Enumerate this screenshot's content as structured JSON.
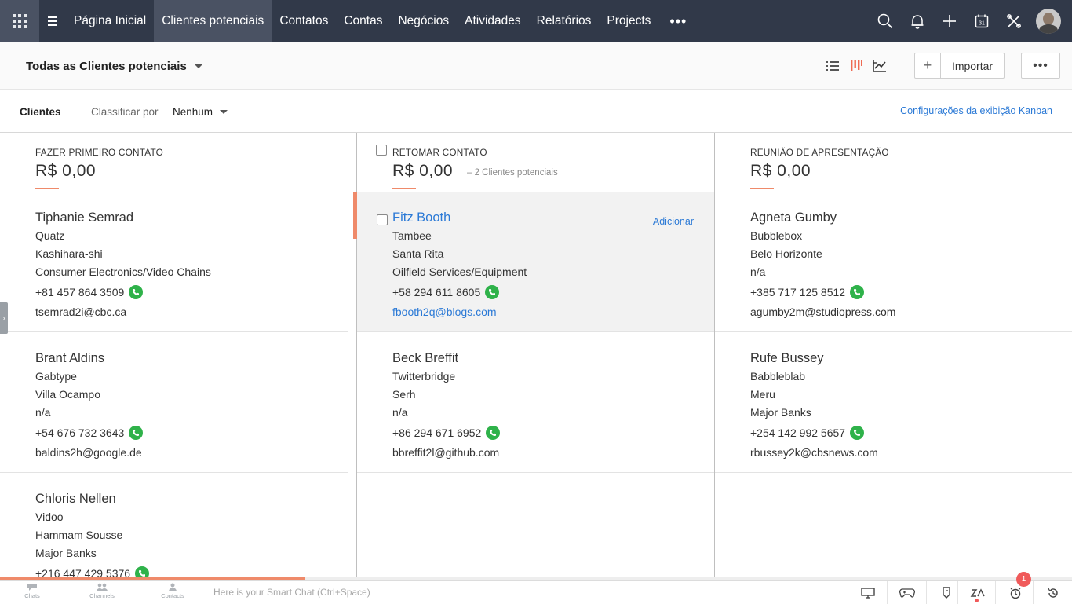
{
  "nav": {
    "tabs": [
      {
        "label": "Página Inicial"
      },
      {
        "label": "Clientes potenciais"
      },
      {
        "label": "Contatos"
      },
      {
        "label": "Contas"
      },
      {
        "label": "Negócios"
      },
      {
        "label": "Atividades"
      },
      {
        "label": "Relatórios"
      },
      {
        "label": "Projects"
      }
    ],
    "active_tab": "Clientes potenciais",
    "more_label": "•••",
    "calendar_day": "31"
  },
  "toolbar": {
    "view_title": "Todas as Clientes potenciais",
    "add_label": "+",
    "import_label": "Importar",
    "more_label": "•••"
  },
  "sortbar": {
    "module": "Clientes",
    "sort_label": "Classificar por",
    "sort_value": "Nenhum",
    "kanban_settings": "Configurações da exibição Kanban"
  },
  "columns": [
    {
      "title": "FAZER PRIMEIRO CONTATO",
      "amount": "R$ 0,00",
      "count": "",
      "cards": [
        {
          "name": "Tiphanie Semrad",
          "company": "Quatz",
          "city": "Kashihara-shi",
          "industry": "Consumer Electronics/Video Chains",
          "phone": "+81 457 864 3509",
          "email": "tsemrad2i@cbc.ca"
        },
        {
          "name": "Brant Aldins",
          "company": "Gabtype",
          "city": "Villa Ocampo",
          "industry": "n/a",
          "phone": "+54 676 732 3643",
          "email": "baldins2h@google.de"
        },
        {
          "name": "Chloris Nellen",
          "company": "Vidoo",
          "city": "Hammam Sousse",
          "industry": "Major Banks",
          "phone": "+216 447 429 5376",
          "email": ""
        }
      ]
    },
    {
      "title": "RETOMAR CONTATO",
      "amount": "R$ 0,00",
      "count": "2 Clientes potenciais",
      "cards": [
        {
          "name": "Fitz Booth",
          "company": "Tambee",
          "city": "Santa Rita",
          "industry": "Oilfield Services/Equipment",
          "phone": "+58 294 611 8605",
          "email": "fbooth2q@blogs.com",
          "action": "Adicionar"
        },
        {
          "name": "Beck Breffit",
          "company": "Twitterbridge",
          "city": "Serh",
          "industry": "n/a",
          "phone": "+86 294 671 6952",
          "email": "bbreffit2l@github.com"
        }
      ]
    },
    {
      "title": "REUNIÃO DE APRESENTAÇÃO",
      "amount": "R$ 0,00",
      "count": "",
      "cards": [
        {
          "name": "Agneta Gumby",
          "company": "Bubblebox",
          "city": "Belo Horizonte",
          "industry": "n/a",
          "phone": "+385 717 125 8512",
          "email": "agumby2m@studiopress.com"
        },
        {
          "name": "Rufe Bussey",
          "company": "Babbleblab",
          "city": "Meru",
          "industry": "Major Banks",
          "phone": "+254 142 992 5657",
          "email": "rbussey2k@cbsnews.com"
        }
      ]
    }
  ],
  "bottombar": {
    "tabs": [
      {
        "label": "Chats"
      },
      {
        "label": "Channels"
      },
      {
        "label": "Contacts"
      }
    ],
    "smartchat_placeholder": "Here is your Smart Chat (Ctrl+Space)",
    "notification_count": "1",
    "progress": 0.285
  },
  "colors": {
    "nav_bg": "#313949",
    "nav_active": "#4a5263",
    "accent": "#ef8a6a",
    "link": "#2c7ad6",
    "phone_green": "#2fb24a"
  },
  "icons": [
    "apps-grid-icon",
    "hamburger-menu-icon",
    "search-icon",
    "bell-icon",
    "plus-icon",
    "calendar-icon",
    "tools-icon",
    "list-view-icon",
    "kanban-view-icon",
    "chart-view-icon",
    "phone-icon",
    "chat-icon",
    "channels-icon",
    "contacts-icon",
    "screen-icon",
    "gamepad-icon",
    "bot-icon",
    "zia-icon",
    "alarm-icon",
    "history-icon"
  ]
}
